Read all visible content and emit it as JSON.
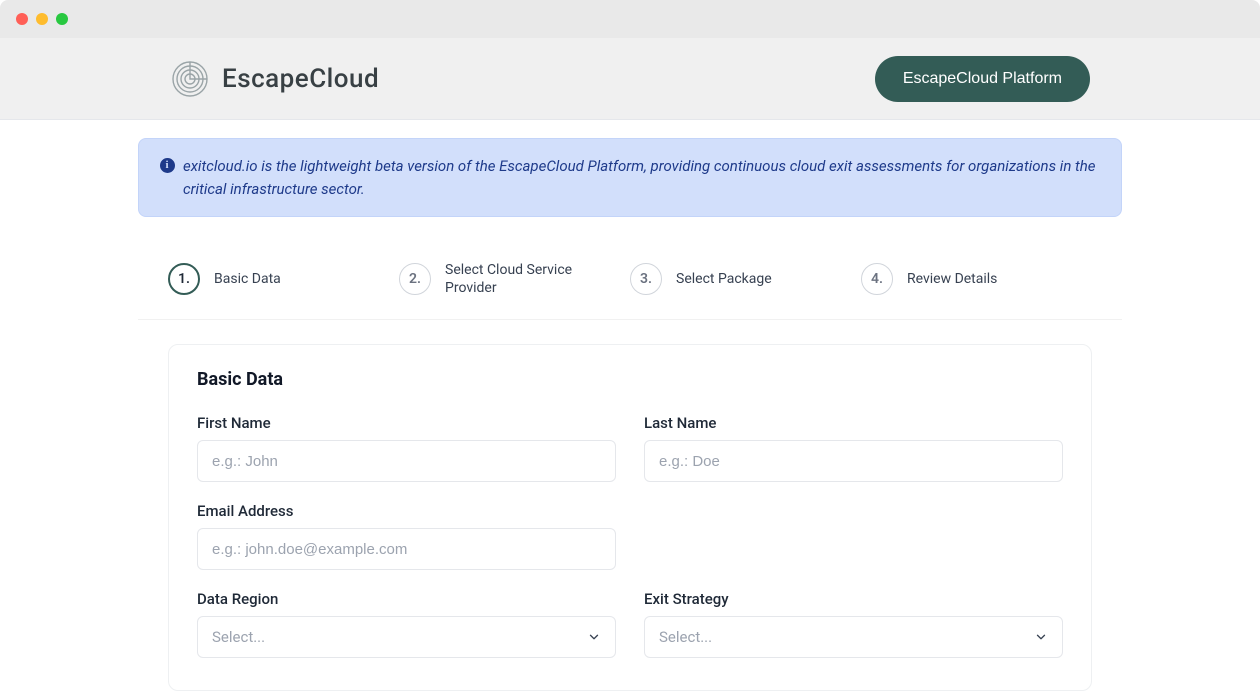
{
  "brand": {
    "name": "EscapeCloud"
  },
  "header": {
    "platform_button": "EscapeCloud Platform"
  },
  "banner": {
    "text": "exitcloud.io is the lightweight beta version of the EscapeCloud Platform, providing continuous cloud exit assessments for organizations in the critical infrastructure sector."
  },
  "stepper": {
    "steps": [
      {
        "num": "1.",
        "label": "Basic Data"
      },
      {
        "num": "2.",
        "label": "Select Cloud Service Provider"
      },
      {
        "num": "3.",
        "label": "Select Package"
      },
      {
        "num": "4.",
        "label": "Review Details"
      }
    ],
    "active_index": 0
  },
  "form": {
    "title": "Basic Data",
    "first_name": {
      "label": "First Name",
      "placeholder": "e.g.: John",
      "value": ""
    },
    "last_name": {
      "label": "Last Name",
      "placeholder": "e.g.: Doe",
      "value": ""
    },
    "email": {
      "label": "Email Address",
      "placeholder": "e.g.: john.doe@example.com",
      "value": ""
    },
    "data_region": {
      "label": "Data Region",
      "placeholder": "Select...",
      "value": ""
    },
    "exit_strategy": {
      "label": "Exit Strategy",
      "placeholder": "Select...",
      "value": ""
    }
  }
}
